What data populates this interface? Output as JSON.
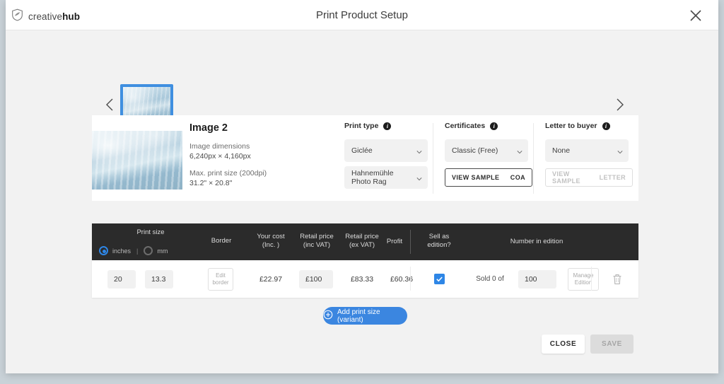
{
  "brand": {
    "name_light": "creative",
    "name_bold": "hub",
    "logo_icon": "shield-swoosh-icon"
  },
  "header": {
    "title": "Print Product Setup",
    "close_icon": "close-icon"
  },
  "carousel": {
    "prev_icon": "chevron-left-icon",
    "next_icon": "chevron-right-icon",
    "thumb_alt": "Image 2 thumbnail"
  },
  "detail": {
    "image_title": "Image 2",
    "dimensions_label": "Image dimensions",
    "dimensions_value": "6,240px × 4,160px",
    "maxsize_label": "Max. print size (200dpi)",
    "maxsize_value": "31.2\" × 20.8\""
  },
  "print_type": {
    "label": "Print type",
    "info_icon": "info-icon",
    "process_value": "Giclée",
    "paper_value": "Hahnemühle Photo Rag",
    "chevron_icon": "chevron-down-icon"
  },
  "certificates": {
    "label": "Certificates",
    "info_icon": "info-icon",
    "select_value": "Classic (Free)",
    "chevron_icon": "chevron-down-icon",
    "sample_button": "VIEW SAMPLE",
    "sample_suffix": "COA"
  },
  "letter_to_buyer": {
    "label": "Letter to buyer",
    "info_icon": "info-icon",
    "select_value": "None",
    "chevron_icon": "chevron-down-icon",
    "sample_button": "VIEW SAMPLE",
    "sample_suffix": "LETTER"
  },
  "table": {
    "headers": {
      "print_size": "Print size",
      "border": "Border",
      "your_cost_l1": "Your cost",
      "your_cost_l2": "(Inc. )",
      "retail_inc_l1": "Retail price",
      "retail_inc_l2": "(inc VAT)",
      "retail_ex_l1": "Retail price",
      "retail_ex_l2": "(ex VAT)",
      "profit": "Profit",
      "sell_as_l1": "Sell as",
      "sell_as_l2": "edition?",
      "number_in_edition": "Number in edition"
    },
    "units": {
      "inches": "inches",
      "mm": "mm",
      "separator": "|",
      "selected": "inches"
    },
    "row": {
      "width": "20",
      "height": "13.3",
      "border_button_l1": "Edit",
      "border_button_l2": "border",
      "your_cost": "£22.97",
      "retail_inc_vat": "£100",
      "retail_ex_vat": "£83.33",
      "profit": "£60.36",
      "sell_as_edition": true,
      "check_icon": "check-icon",
      "sold_label": "Sold 0 of",
      "edition_size": "100",
      "manage_button_l1": "Manage",
      "manage_button_l2": "Edition",
      "delete_icon": "trash-icon"
    }
  },
  "footer": {
    "add_variant_label": "Add print size (variant)",
    "add_icon": "plus-circle-icon",
    "close_label": "CLOSE",
    "save_label": "SAVE"
  },
  "colors": {
    "accent_blue": "#3b86e0",
    "header_dark": "#2b2b2b",
    "disabled_grey": "#dcdcdc"
  }
}
